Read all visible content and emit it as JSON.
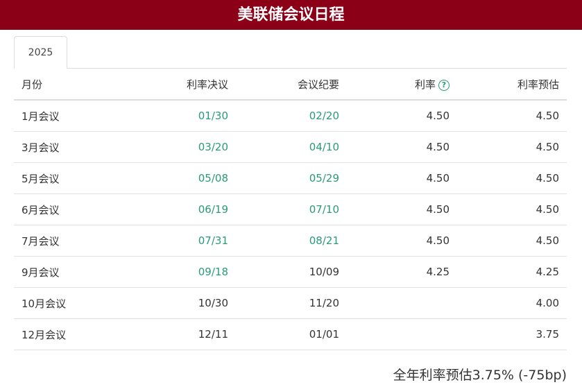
{
  "header": {
    "title": "美联储会议日程"
  },
  "tabs": [
    {
      "label": "2025"
    }
  ],
  "table": {
    "headers": {
      "month": "月份",
      "decision": "利率决议",
      "minutes": "会议纪要",
      "rate": "利率",
      "forecast": "利率预估"
    },
    "rows": [
      {
        "month": "1月会议",
        "decision": "01/30",
        "minutes": "02/20",
        "rate": "4.50",
        "forecast": "4.50"
      },
      {
        "month": "3月会议",
        "decision": "03/20",
        "minutes": "04/10",
        "rate": "4.50",
        "forecast": "4.50"
      },
      {
        "month": "5月会议",
        "decision": "05/08",
        "minutes": "05/29",
        "rate": "4.50",
        "forecast": "4.50"
      },
      {
        "month": "6月会议",
        "decision": "06/19",
        "minutes": "07/10",
        "rate": "4.50",
        "forecast": "4.50"
      },
      {
        "month": "7月会议",
        "decision": "07/31",
        "minutes": "08/21",
        "rate": "4.50",
        "forecast": "4.50"
      },
      {
        "month": "9月会议",
        "decision": "09/18",
        "minutes": "10/09",
        "rate": "4.25",
        "forecast": "4.25"
      },
      {
        "month": "10月会议",
        "decision": "10/30",
        "minutes": "11/20",
        "rate": "",
        "forecast": "4.00"
      },
      {
        "month": "12月会议",
        "decision": "12/11",
        "minutes": "01/01",
        "rate": "",
        "forecast": "3.75"
      }
    ]
  },
  "footer": {
    "summary": "全年利率预估3.75% (-75bp)"
  },
  "colors": {
    "brand": "#8b0016",
    "link": "#2a9a78"
  }
}
